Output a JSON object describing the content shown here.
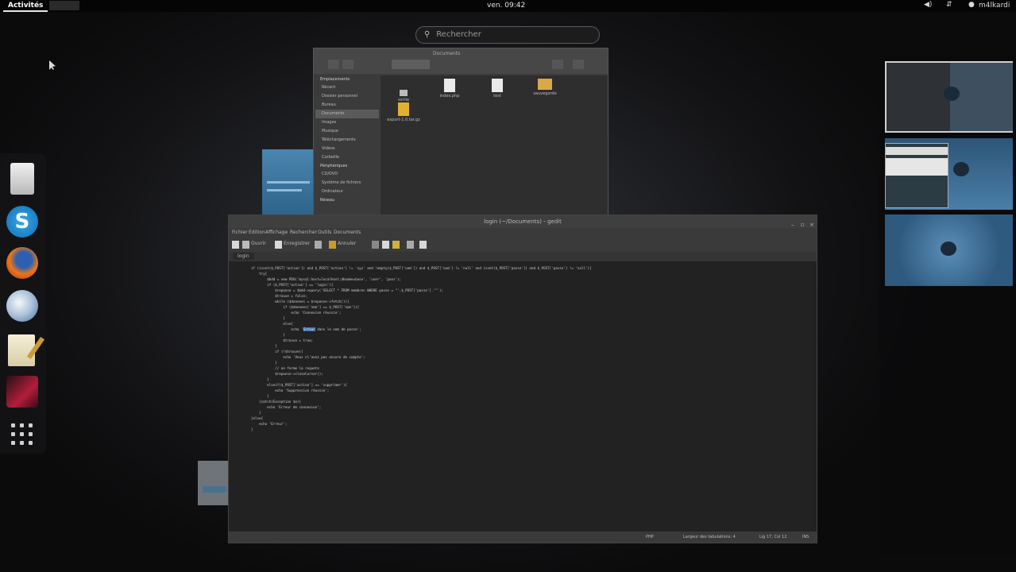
{
  "topbar": {
    "activities": "Activités",
    "clock": "ven. 09:42",
    "volume_icon": "◀)",
    "network_icon": "⇵",
    "user_icon": "●",
    "user_name": "m4lkardi"
  },
  "search": {
    "placeholder": "Rechercher"
  },
  "dash": {
    "apps": [
      "files-icon",
      "skype-icon",
      "firefox-icon",
      "web-browser-icon",
      "text-editor-icon",
      "red-app-icon",
      "show-applications-icon"
    ],
    "skype_glyph": "S"
  },
  "file_manager": {
    "title": "Documents",
    "sidebar_header_1": "Emplacements",
    "places": [
      "Récent",
      "Dossier personnel",
      "Bureau",
      "Documents",
      "Images",
      "Musique",
      "Téléchargements",
      "Vidéos",
      "Corbeille"
    ],
    "sidebar_header_2": "Périphériques",
    "devices": [
      "CD/DVD",
      "Système de fichiers",
      "Ordinateur"
    ],
    "sidebar_header_3": "Réseau",
    "files": [
      {
        "name": "index.php"
      },
      {
        "name": "test"
      },
      {
        "name": "sauvegarde"
      },
      {
        "name": "sortie"
      },
      {
        "name": "export-1.0.tar.gz"
      }
    ]
  },
  "gedit": {
    "title": "login (~/Documents) - gedit",
    "menu": [
      "Fichier",
      "Édition",
      "Affichage",
      "Rechercher",
      "Outils",
      "Documents"
    ],
    "toolbar": {
      "open": "Ouvrir",
      "save": "Enregistrer",
      "undo": "Annuler"
    },
    "tab": "login",
    "code_lines": [
      "if (isset($_POST['action']) and $_POST['action'] != 'xyz' and !empty($_POST['nom']) and $_POST['nom'] != 'null' and isset($_POST['passe']) and $_POST['passe'] != 'null'){",
      "    try{",
      "        $bdd = new PDO('mysql:host=localhost;dbname=base', 'user', 'pass');",
      "        if ($_POST['action'] == 'login'){",
      "            $reponse = $bdd->query('SELECT * FROM membres WHERE passe = \"'.$_POST['passe'].'\"');",
      "            $trouve = false;",
      "            while ($donnees = $reponse->fetch()){",
      "                if ($donnees['nom'] == $_POST['nom']){",
      "                    echo 'Connexion réussie';",
      "                }",
      "                else{",
      "                    echo 'Erreur dans le nom de passe';",
      "                }",
      "                $trouve = true;",
      "            }",
      "            if (!$trouve){",
      "                echo 'Vous n\\'avez pas encore de compte';",
      "            }",
      "            // on ferme la requete",
      "            $reponse->closeCursor();",
      "        }",
      "        elseif($_POST['action'] == 'supprimer'){",
      "            echo 'Suppression réussie';",
      "        }",
      "    }catch(Exception $e){",
      "        echo 'Erreur de connexion';",
      "    }",
      "}else{",
      "    echo 'Erreur';",
      "}"
    ],
    "highlight_word": "Erreur",
    "status": {
      "language": "PHP",
      "tab_width": "Largeur des tabulations: 4",
      "position": "Lig 17, Col 12",
      "mode": "INS"
    }
  },
  "workspaces": [
    {
      "label": "workspace-1"
    },
    {
      "label": "workspace-2"
    },
    {
      "label": "workspace-3"
    }
  ]
}
